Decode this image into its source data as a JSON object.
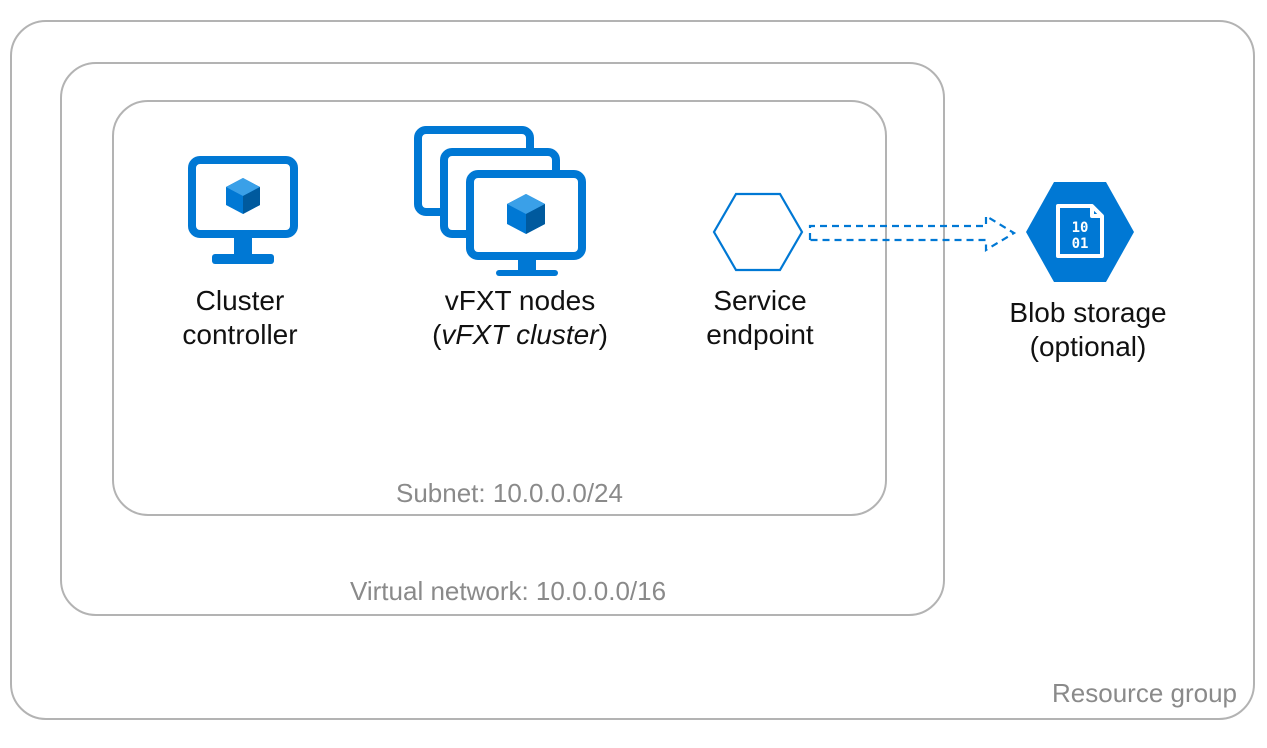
{
  "resource_group": {
    "label": "Resource group"
  },
  "vnet": {
    "label": "Virtual network: 10.0.0.0/16"
  },
  "subnet": {
    "label": "Subnet: 10.0.0.0/24"
  },
  "cluster_controller": {
    "line1": "Cluster",
    "line2": "controller"
  },
  "vfxt_nodes": {
    "line1": "vFXT nodes",
    "line2": "(",
    "line2_italic": "vFXT cluster",
    "line2_close": ")"
  },
  "service_endpoint": {
    "line1": "Service",
    "line2": "endpoint"
  },
  "blob_storage": {
    "line1": "Blob storage",
    "line2": "(optional)"
  },
  "colors": {
    "azure_blue": "#0078D4"
  }
}
